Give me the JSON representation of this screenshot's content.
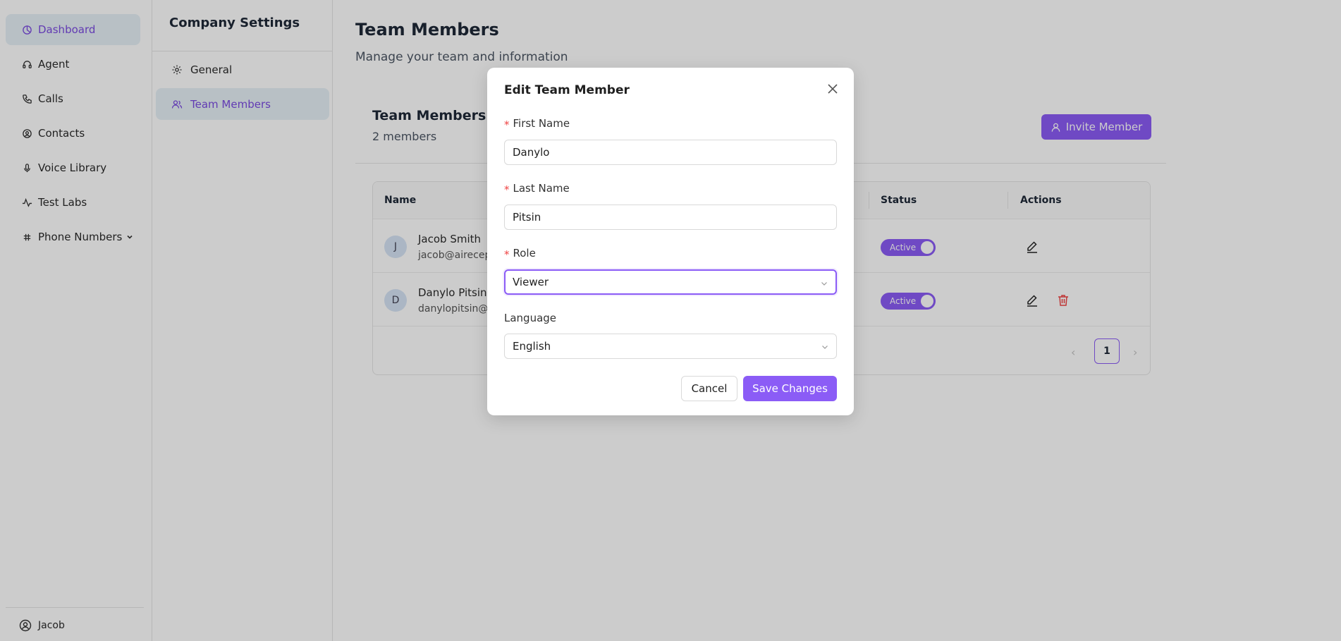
{
  "sidebar": {
    "items": [
      {
        "label": "Dashboard",
        "icon": "dashboard-icon"
      },
      {
        "label": "Agent",
        "icon": "headset-icon"
      },
      {
        "label": "Calls",
        "icon": "phone-icon"
      },
      {
        "label": "Contacts",
        "icon": "contacts-icon"
      },
      {
        "label": "Voice Library",
        "icon": "microphone-icon"
      },
      {
        "label": "Test Labs",
        "icon": "activity-icon"
      },
      {
        "label": "Phone Numbers",
        "icon": "hash-icon"
      }
    ],
    "user": "Jacob"
  },
  "settings": {
    "title": "Company Settings",
    "items": [
      {
        "label": "General",
        "icon": "gear-icon"
      },
      {
        "label": "Team Members",
        "icon": "users-icon"
      }
    ]
  },
  "main": {
    "title": "Team Members",
    "subtitle": "Manage your team and information",
    "card_title": "Team Members",
    "card_count": "2 members",
    "invite_label": "Invite Member",
    "columns": [
      "Name",
      "Status",
      "Actions"
    ],
    "members": [
      {
        "initial": "J",
        "name": "Jacob Smith",
        "email": "jacob@airecep",
        "status": "Active"
      },
      {
        "initial": "D",
        "name": "Danylo Pitsin",
        "email": "danylopitsin@g",
        "status": "Active"
      }
    ],
    "pagination": {
      "current": "1",
      "prev": "‹",
      "next": "›"
    }
  },
  "modal": {
    "title": "Edit Team Member",
    "first_name": {
      "label": "First Name",
      "value": "Danylo",
      "required": "*"
    },
    "last_name": {
      "label": "Last Name",
      "value": "Pitsin",
      "required": "*"
    },
    "role": {
      "label": "Role",
      "value": "Viewer",
      "required": "*"
    },
    "language": {
      "label": "Language",
      "value": "English"
    },
    "cancel_label": "Cancel",
    "save_label": "Save Changes"
  },
  "colors": {
    "accent": "#8b5cf6",
    "active_nav_bg": "#e6f0f7",
    "danger": "#ef4444"
  }
}
